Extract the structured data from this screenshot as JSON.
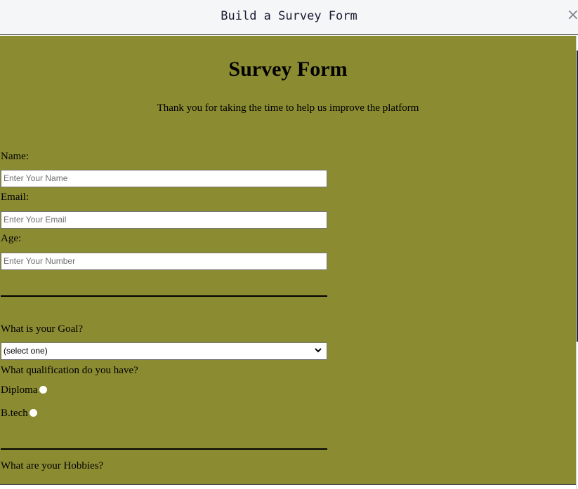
{
  "window": {
    "title": "Build a Survey Form",
    "close_glyph": "×"
  },
  "form": {
    "title": "Survey Form",
    "description": "Thank you for taking the time to help us improve the platform",
    "name": {
      "label": "Name:",
      "placeholder": "Enter Your Name"
    },
    "email": {
      "label": "Email:",
      "placeholder": "Enter Your Email"
    },
    "age": {
      "label": "Age:",
      "placeholder": "Enter Your Number"
    },
    "goal": {
      "label": "What is your Goal?",
      "selected": "(select one)"
    },
    "qualification": {
      "label": "What qualification do you have?",
      "options": [
        "Diploma",
        "B.tech"
      ]
    },
    "hobbies": {
      "label": "What are your Hobbies?"
    }
  },
  "colors": {
    "form_background": "#8b8b32",
    "titlebar": "#f5f6f7"
  }
}
